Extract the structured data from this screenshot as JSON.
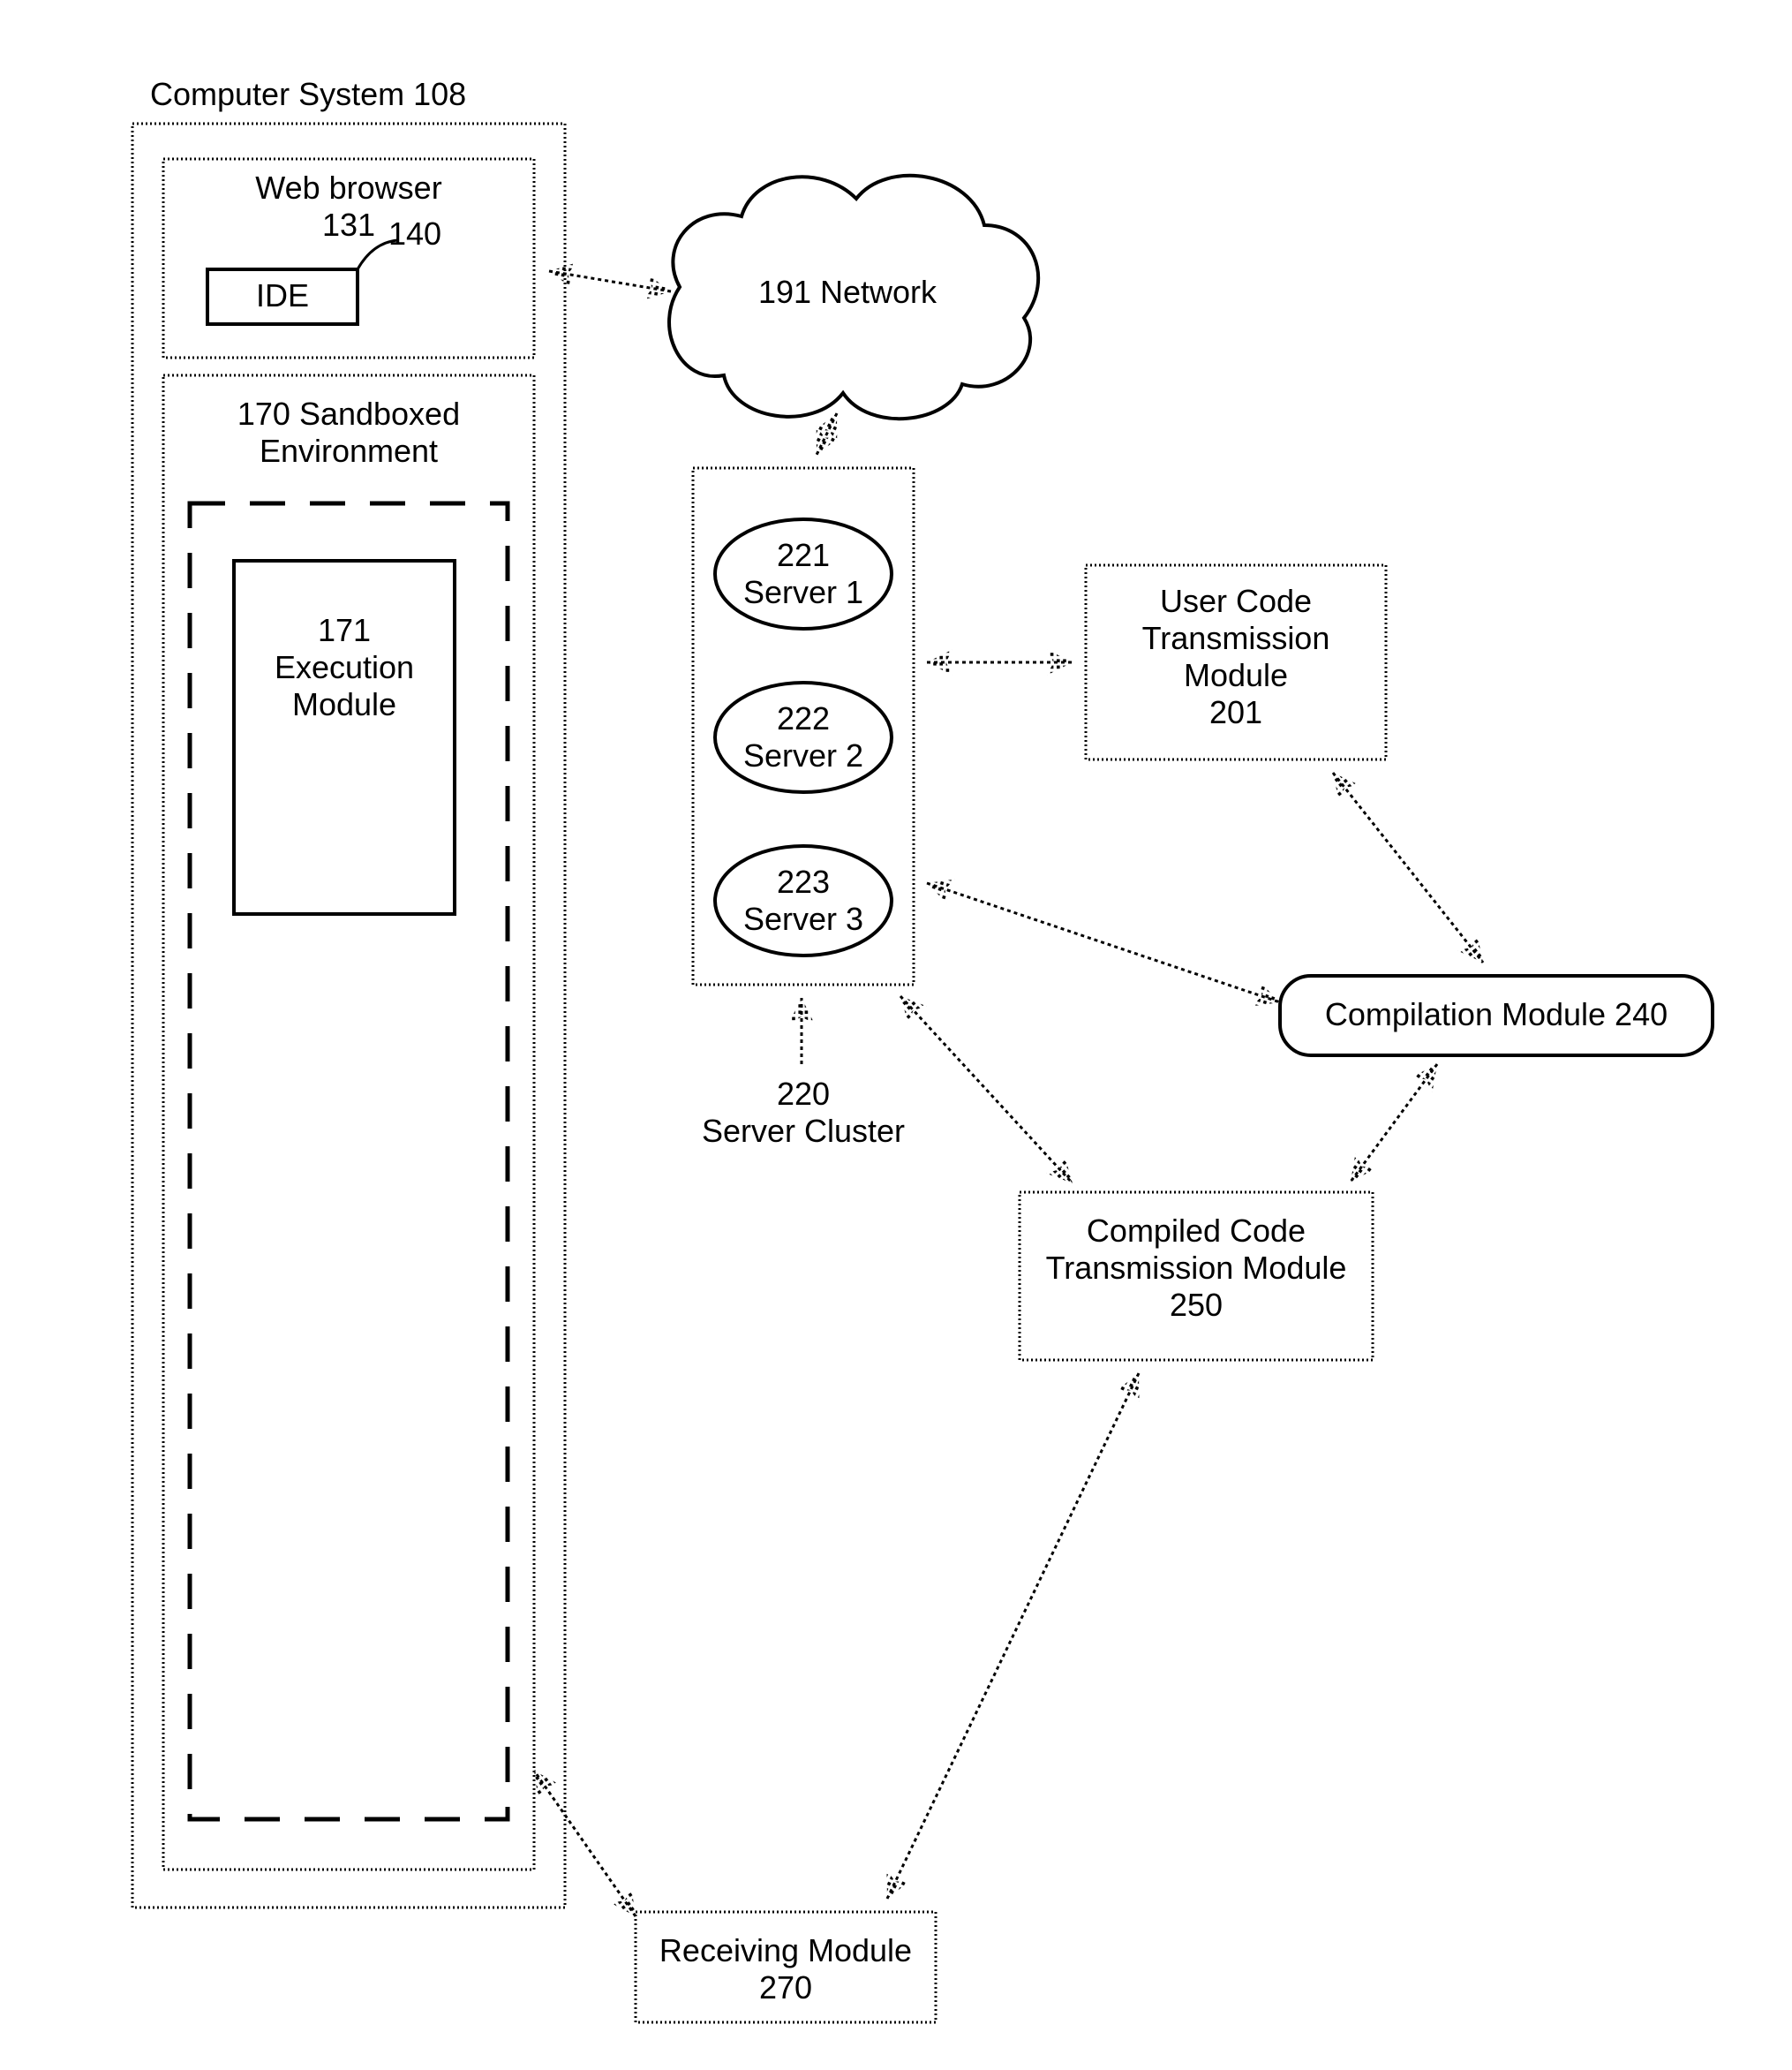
{
  "title": "Computer System 108",
  "browser": {
    "label_l1": "Web browser",
    "label_l2": "131"
  },
  "ide": {
    "label": "IDE",
    "ref": "140"
  },
  "sandbox": {
    "label_l1": "170 Sandboxed",
    "label_l2": "Environment"
  },
  "exec": {
    "label_l1": "171",
    "label_l2": "Execution",
    "label_l3": "Module"
  },
  "network": {
    "label": "191 Network"
  },
  "cluster": {
    "caption_l1": "220",
    "caption_l2": "Server Cluster",
    "s1_l1": "221",
    "s1_l2": "Server 1",
    "s2_l1": "222",
    "s2_l2": "Server 2",
    "s3_l1": "223",
    "s3_l2": "Server 3"
  },
  "usercode": {
    "l1": "User Code",
    "l2": "Transmission",
    "l3": "Module",
    "l4": "201"
  },
  "compilation": {
    "label": "Compilation Module 240"
  },
  "compiled": {
    "l1": "Compiled Code",
    "l2": "Transmission Module",
    "l3": "250"
  },
  "receiving": {
    "l1": "Receiving Module",
    "l2": "270"
  }
}
